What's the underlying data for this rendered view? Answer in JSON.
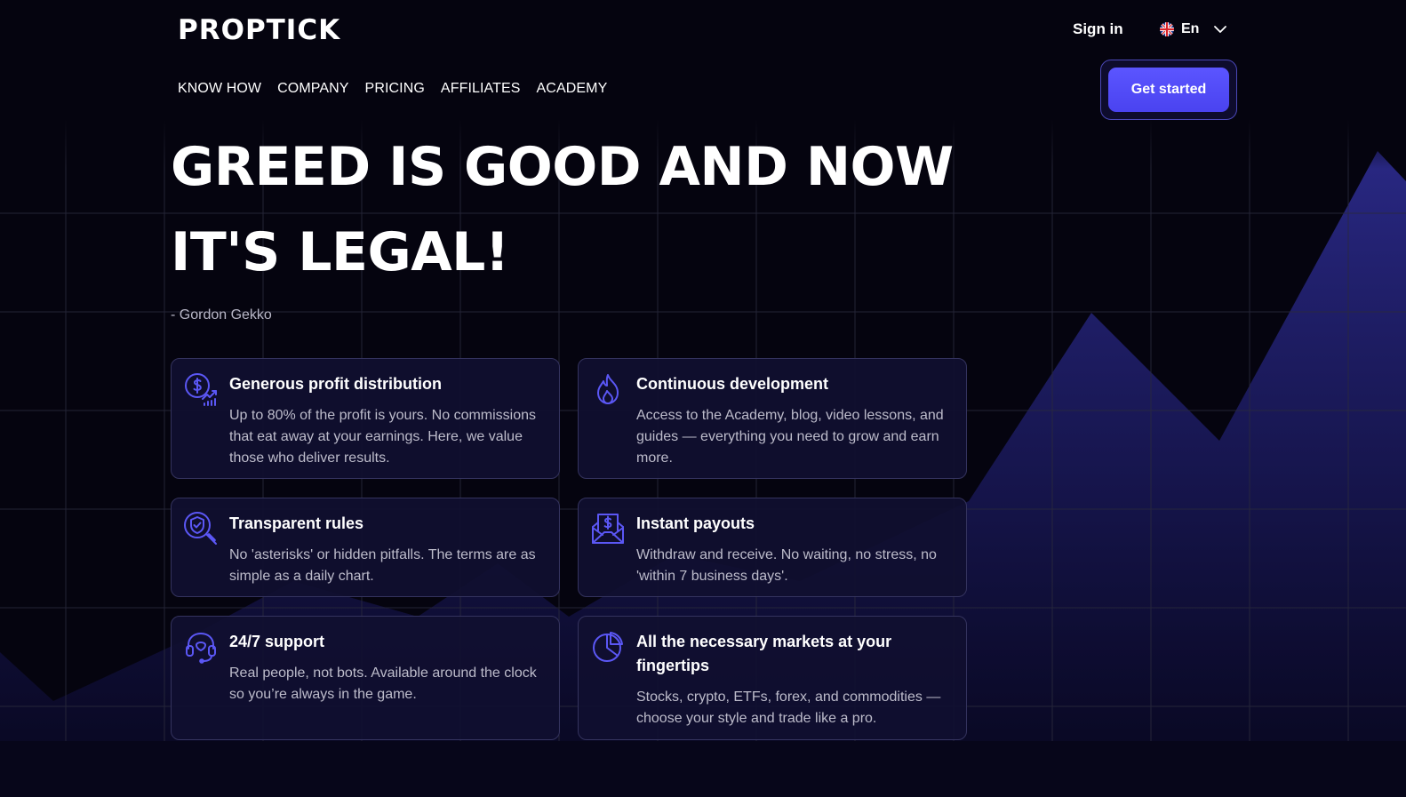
{
  "brand": {
    "logo_text": "PROPTICK",
    "accent": "#4f4af5"
  },
  "header": {
    "sign_in": "Sign in",
    "language": {
      "code": "En",
      "flag": "uk-flag-icon"
    },
    "cta": "Get started"
  },
  "nav": {
    "items": [
      {
        "label": "KNOW HOW"
      },
      {
        "label": "COMPANY"
      },
      {
        "label": "PRICING"
      },
      {
        "label": "AFFILIATES"
      },
      {
        "label": "ACADEMY"
      }
    ]
  },
  "hero": {
    "line1": "GREED IS GOOD AND NOW",
    "line2": "IT'S LEGAL!",
    "author": "- Gordon Gekko"
  },
  "features": [
    {
      "icon": "profit-dollar-chart-icon",
      "title": "Generous profit distribution",
      "text": "Up to 80% of the profit is yours. No commissions that eat away at your earnings. Here, we value those who deliver results."
    },
    {
      "icon": "flame-icon",
      "title": "Continuous development",
      "text": "Access to the Academy, blog, video lessons, and guides — everything you need to grow and earn more."
    },
    {
      "icon": "shield-search-icon",
      "title": "Transparent rules",
      "text": "No 'asterisks' or hidden pitfalls. The terms are as simple as a daily chart."
    },
    {
      "icon": "dollar-envelope-icon",
      "title": "Instant payouts",
      "text": "Withdraw and receive. No waiting, no stress, no 'within 7 business days'."
    },
    {
      "icon": "headset-icon",
      "title": "24/7 support",
      "text": "Real people, not bots. Available around the clock so you’re always in the game."
    },
    {
      "icon": "pie-chart-icon",
      "title": "All the necessary markets at your fingertips",
      "text": "Stocks, crypto, ETFs, forex, and commodities — choose your style and trade like a pro."
    }
  ]
}
